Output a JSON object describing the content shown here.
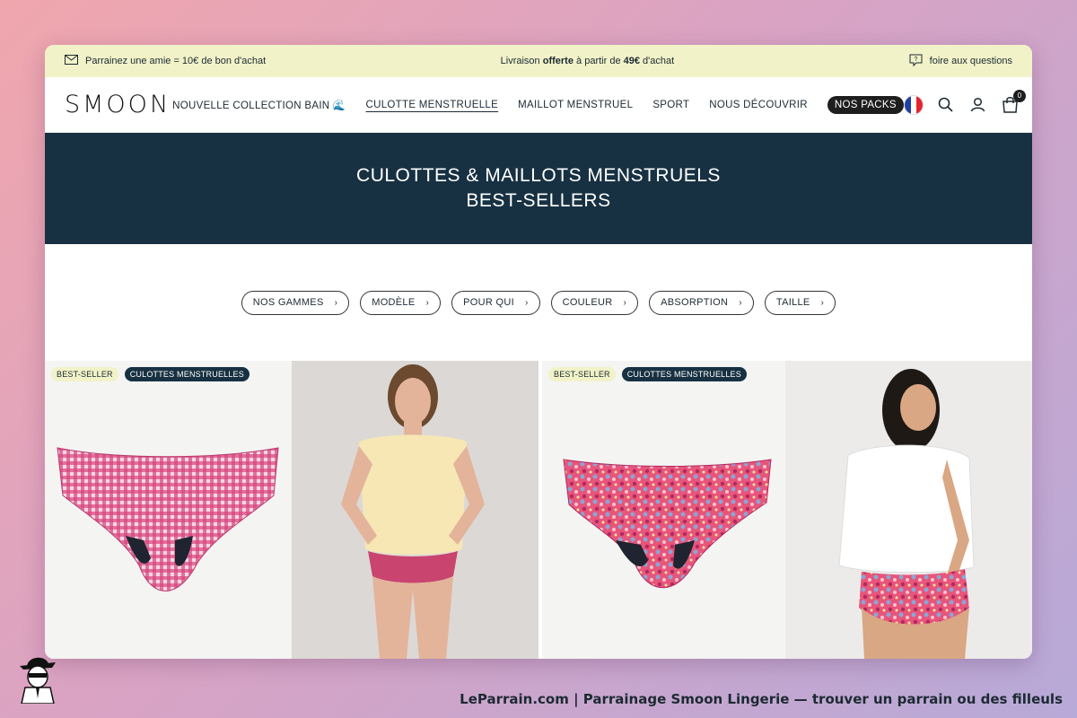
{
  "announcement": {
    "referral_text": "Parrainez une amie = 10€ de bon d'achat",
    "shipping_prefix": "Livraison",
    "shipping_bold": "offerte",
    "shipping_middle": "à partir de",
    "shipping_amount": "49€",
    "shipping_suffix": "d'achat",
    "faq_text": "foire aux questions"
  },
  "header": {
    "logo_text": "SMOON",
    "nav": [
      {
        "label": "NOUVELLE COLLECTION BAIN 🌊"
      },
      {
        "label": "CULOTTE MENSTRUELLE"
      },
      {
        "label": "MAILLOT MENSTRUEL"
      },
      {
        "label": "SPORT"
      },
      {
        "label": "NOUS DÉCOUVRIR"
      },
      {
        "label": "NOS PACKS"
      }
    ],
    "cart_count": "0"
  },
  "hero": {
    "line1": "CULOTTES & MAILLOTS MENSTRUELS",
    "line2": "BEST-SELLERS"
  },
  "filters": [
    {
      "label": "NOS GAMMES"
    },
    {
      "label": "MODÈLE"
    },
    {
      "label": "POUR QUI"
    },
    {
      "label": "COULEUR"
    },
    {
      "label": "ABSORPTION"
    },
    {
      "label": "TAILLE"
    }
  ],
  "products": [
    {
      "badge1": "BEST-SELLER",
      "badge2": "CULOTTES MENSTRUELLES"
    },
    {
      "badge1": "BEST-SELLER",
      "badge2": "CULOTTES MENSTRUELLES"
    }
  ],
  "icons": {
    "mail": "mail-icon",
    "faq": "question-bubble-icon",
    "search": "search-icon",
    "account": "user-icon",
    "cart": "bag-icon",
    "language": "french-flag-icon"
  },
  "colors": {
    "announce_bg": "#f1f2c8",
    "hero_bg": "#173142",
    "pill_bg": "#1e1e1e"
  },
  "footer_caption": "LeParrain.com | Parrainage Smoon Lingerie — trouver un parrain ou des filleuls"
}
